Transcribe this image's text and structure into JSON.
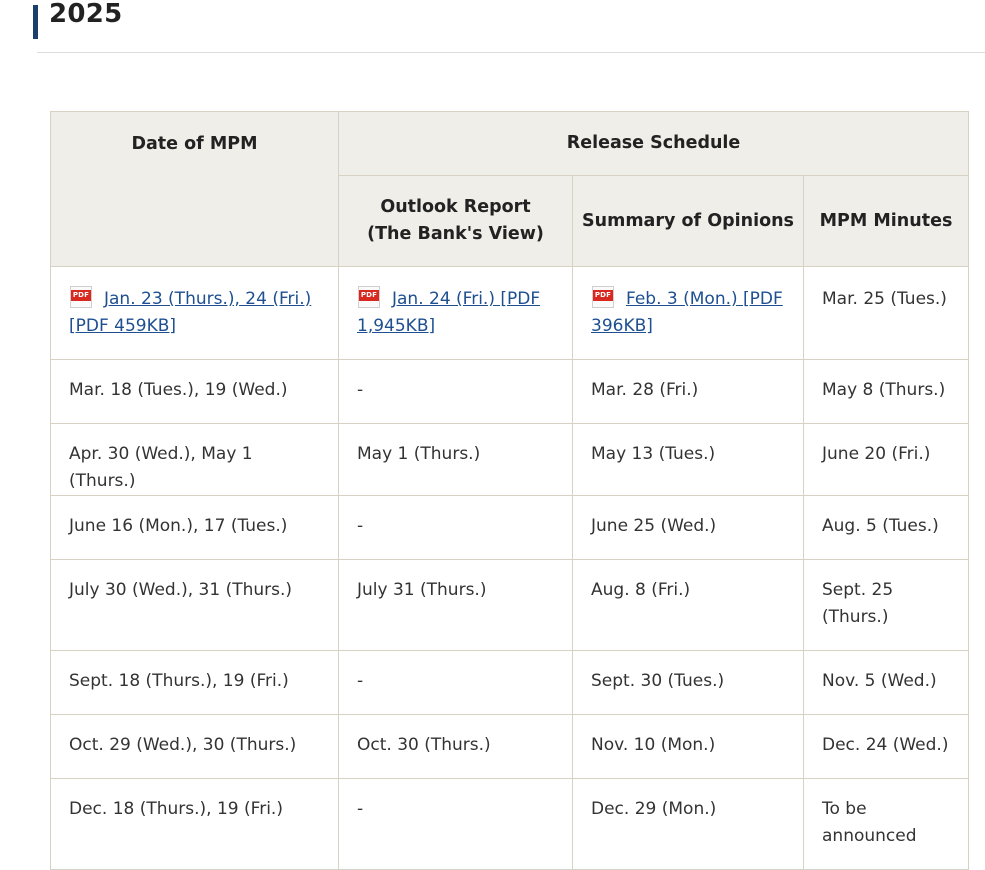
{
  "heading": {
    "year": "2025"
  },
  "table": {
    "headers": {
      "date_of_mpm": "Date of MPM",
      "release_schedule": "Release Schedule",
      "outlook_report_line1": "Outlook Report",
      "outlook_report_line2": "(The Bank's View)",
      "summary_of_opinions": "Summary of Opinions",
      "mpm_minutes": "MPM Minutes"
    },
    "rows": [
      {
        "date": "Jan. 23 (Thurs.), 24 (Fri.) [PDF 459KB]",
        "outlook": "Jan. 24 (Fri.) [PDF 1,945KB]",
        "summary": "Feb. 3 (Mon.) [PDF 396KB]",
        "minutes": "Mar. 25 (Tues.)"
      },
      {
        "date": "Mar. 18 (Tues.), 19 (Wed.)",
        "outlook": "-",
        "summary": "Mar. 28 (Fri.)",
        "minutes": "May 8 (Thurs.)"
      },
      {
        "date": "Apr. 30 (Wed.), May 1 (Thurs.)",
        "outlook": "May 1 (Thurs.)",
        "summary": "May 13 (Tues.)",
        "minutes": "June 20 (Fri.)"
      },
      {
        "date": "June 16 (Mon.), 17 (Tues.)",
        "outlook": "-",
        "summary": "June 25 (Wed.)",
        "minutes": "Aug. 5 (Tues.)"
      },
      {
        "date": "July 30 (Wed.), 31 (Thurs.)",
        "outlook": "July 31 (Thurs.)",
        "summary": "Aug. 8 (Fri.)",
        "minutes": "Sept. 25 (Thurs.)"
      },
      {
        "date": "Sept. 18 (Thurs.), 19 (Fri.)",
        "outlook": "-",
        "summary": "Sept. 30 (Tues.)",
        "minutes": "Nov. 5 (Wed.)"
      },
      {
        "date": "Oct. 29 (Wed.), 30 (Thurs.)",
        "outlook": "Oct. 30 (Thurs.)",
        "summary": "Nov. 10 (Mon.)",
        "minutes": "Dec. 24 (Wed.)"
      },
      {
        "date": "Dec. 18 (Thurs.), 19 (Fri.)",
        "outlook": "-",
        "summary": "Dec. 29 (Mon.)",
        "minutes": "To be announced"
      }
    ]
  },
  "icons": {
    "pdf_label": "PDF"
  },
  "colors": {
    "accent": "#1b3f6d",
    "link": "#1d4f91",
    "header_bg": "#f0eee9",
    "border": "#d8d2c4",
    "pdf_red": "#d9281f"
  }
}
